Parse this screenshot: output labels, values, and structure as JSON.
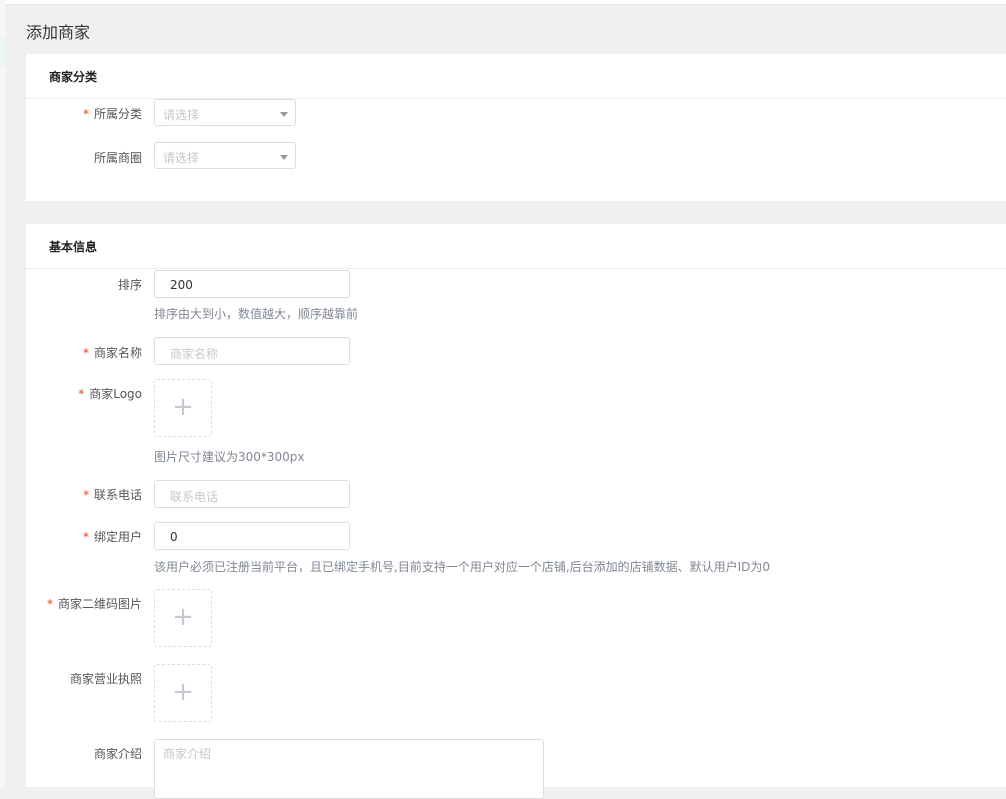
{
  "page": {
    "title": "添加商家"
  },
  "category_card": {
    "title": "商家分类",
    "category": {
      "label": "所属分类",
      "required": true,
      "placeholder": "请选择"
    },
    "district": {
      "label": "所属商圈",
      "required": false,
      "placeholder": "请选择"
    }
  },
  "basic_card": {
    "title": "基本信息",
    "sort": {
      "label": "排序",
      "value": "200",
      "hint": "排序由大到小，数值越大，顺序越靠前"
    },
    "name": {
      "label": "商家名称",
      "required": true,
      "placeholder": "商家名称"
    },
    "logo": {
      "label": "商家Logo",
      "required": true,
      "plus": "+",
      "hint": "图片尺寸建议为300*300px"
    },
    "phone": {
      "label": "联系电话",
      "required": true,
      "placeholder": "联系电话"
    },
    "bind_user": {
      "label": "绑定用户",
      "required": true,
      "value": "0",
      "hint": "该用户必须已注册当前平台，且已绑定手机号,目前支持一个用户对应一个店铺,后台添加的店铺数据、默认用户ID为0"
    },
    "qrcode": {
      "label": "商家二维码图片",
      "required": true,
      "plus": "+"
    },
    "license": {
      "label": "商家营业执照",
      "required": false,
      "plus": "+"
    },
    "intro": {
      "label": "商家介绍",
      "placeholder": "商家介绍"
    }
  },
  "required_mark": "*"
}
